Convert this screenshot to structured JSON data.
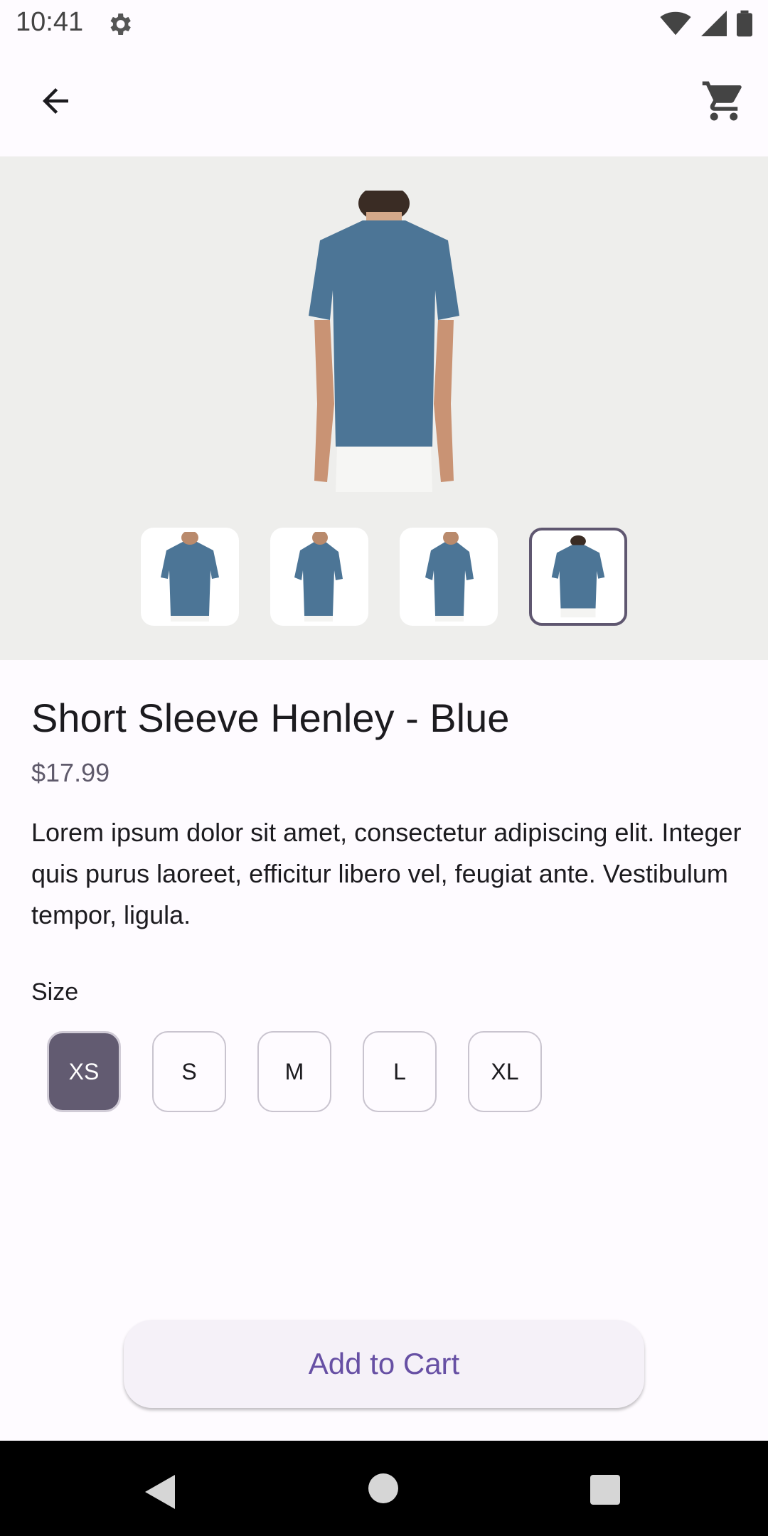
{
  "status_bar": {
    "time": "10:41"
  },
  "toolbar": {
    "back_icon": "arrow-back-icon",
    "cart_icon": "shopping-cart-icon"
  },
  "gallery": {
    "main_image": "blue henley t-shirt back view",
    "thumbnails": [
      {
        "name": "front view",
        "selected": false
      },
      {
        "name": "three-quarter left view",
        "selected": false
      },
      {
        "name": "side view",
        "selected": false
      },
      {
        "name": "back view",
        "selected": true
      }
    ]
  },
  "product": {
    "title": "Short Sleeve Henley - Blue",
    "price": "$17.99",
    "description": "Lorem ipsum dolor sit amet, consectetur adipiscing elit. Integer quis purus laoreet, efficitur libero vel, feugiat ante. Vestibulum tempor, ligula.",
    "size_label": "Size",
    "sizes": [
      "XS",
      "S",
      "M",
      "L",
      "XL"
    ],
    "selected_size": "XS"
  },
  "actions": {
    "add_to_cart": "Add to Cart"
  },
  "colors": {
    "primary": "#6750a4",
    "selected_chip": "#625b71",
    "gallery_bg": "#eeeeec"
  }
}
